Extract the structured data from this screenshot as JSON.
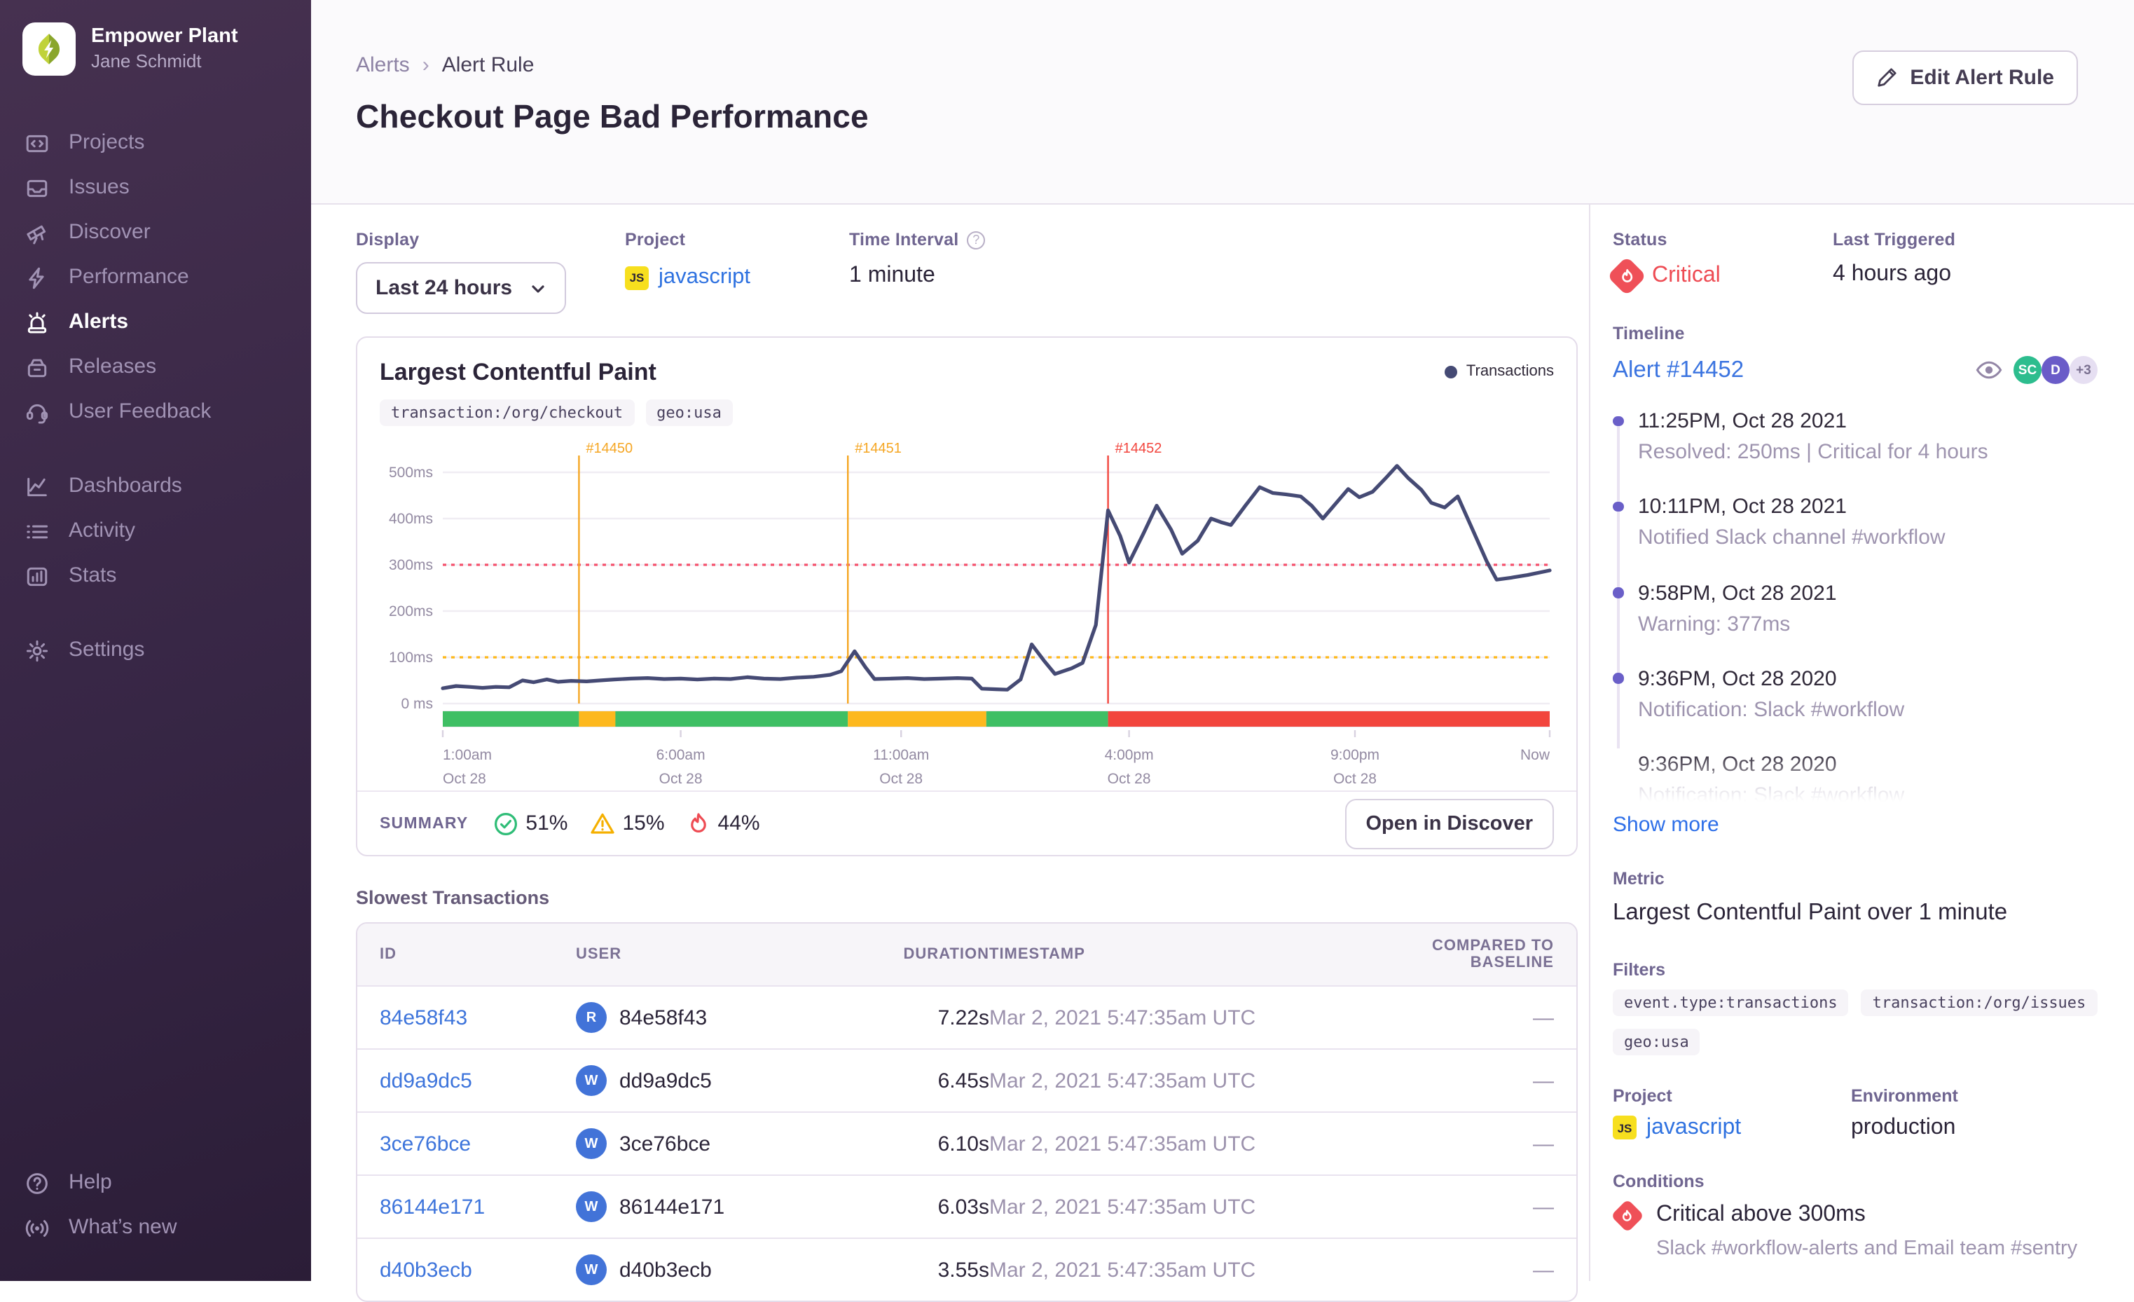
{
  "sidebar": {
    "org": "Empower Plant",
    "user": "Jane Schmidt",
    "primary": [
      {
        "label": "Projects"
      },
      {
        "label": "Issues"
      },
      {
        "label": "Discover"
      },
      {
        "label": "Performance"
      },
      {
        "label": "Alerts"
      },
      {
        "label": "Releases"
      },
      {
        "label": "User Feedback"
      }
    ],
    "secondary": [
      {
        "label": "Dashboards"
      },
      {
        "label": "Activity"
      },
      {
        "label": "Stats"
      }
    ],
    "settings_label": "Settings",
    "footer": [
      {
        "label": "Help"
      },
      {
        "label": "What’s new"
      }
    ]
  },
  "header": {
    "breadcrumb": [
      "Alerts",
      "Alert Rule"
    ],
    "breadcrumb_sep": "›",
    "title": "Checkout Page Bad Performance",
    "edit_button": "Edit Alert Rule"
  },
  "meta": {
    "display": {
      "label": "Display",
      "value": "Last 24 hours"
    },
    "project": {
      "label": "Project",
      "badge": "JS",
      "value": "javascript"
    },
    "interval": {
      "label": "Time Interval",
      "help": "?",
      "value": "1 minute"
    },
    "status": {
      "label": "Status",
      "value": "Critical"
    },
    "last_triggered": {
      "label": "Last Triggered",
      "value": "4 hours ago"
    }
  },
  "chart_data": {
    "type": "line",
    "title": "Largest Contentful Paint",
    "tags": [
      "transaction:/org/checkout",
      "geo:usa"
    ],
    "legend": [
      "Transactions"
    ],
    "ylabel": "ms",
    "ylim": [
      0,
      550
    ],
    "y_ticks": [
      {
        "value": 0,
        "label": "0 ms"
      },
      {
        "value": 100,
        "label": "100ms"
      },
      {
        "value": 200,
        "label": "200ms"
      },
      {
        "value": 300,
        "label": "300ms"
      },
      {
        "value": 400,
        "label": "400ms"
      },
      {
        "value": 500,
        "label": "500ms"
      }
    ],
    "x_ticks": [
      {
        "x": 0,
        "time": "1:00am",
        "date": "Oct 28"
      },
      {
        "x": 0.215,
        "time": "6:00am",
        "date": "Oct 28"
      },
      {
        "x": 0.414,
        "time": "11:00am",
        "date": "Oct 28"
      },
      {
        "x": 0.62,
        "time": "4:00pm",
        "date": "Oct 28"
      },
      {
        "x": 0.824,
        "time": "9:00pm",
        "date": "Oct 28"
      },
      {
        "x": 1,
        "time": "Now",
        "date": ""
      }
    ],
    "thresholds": [
      {
        "name": "critical",
        "value": 300,
        "color": "#f4506c"
      },
      {
        "name": "warning",
        "value": 100,
        "color": "#fdb71a"
      }
    ],
    "incidents": [
      {
        "x": 0.123,
        "label": "#14450",
        "color": "#f5a623"
      },
      {
        "x": 0.366,
        "label": "#14451",
        "color": "#f5a623"
      },
      {
        "x": 0.601,
        "label": "#14452",
        "color": "#f2453d"
      }
    ],
    "segment_colors": {
      "green": "#3fbf64",
      "yellow": "#fdb81e",
      "red": "#f2453d"
    },
    "status_segments": [
      [
        0,
        0.123,
        "green"
      ],
      [
        0.123,
        0.156,
        "yellow"
      ],
      [
        0.156,
        0.366,
        "green"
      ],
      [
        0.366,
        0.491,
        "yellow"
      ],
      [
        0.491,
        0.601,
        "green"
      ],
      [
        0.601,
        1,
        "red"
      ]
    ],
    "series": [
      {
        "name": "Transactions",
        "color": "#454a74",
        "points": [
          [
            0,
            33
          ],
          [
            0.012,
            38
          ],
          [
            0.024,
            36
          ],
          [
            0.036,
            34
          ],
          [
            0.048,
            36
          ],
          [
            0.06,
            35
          ],
          [
            0.072,
            50
          ],
          [
            0.082,
            46
          ],
          [
            0.094,
            52
          ],
          [
            0.104,
            47
          ],
          [
            0.116,
            49
          ],
          [
            0.13,
            48
          ],
          [
            0.142,
            50
          ],
          [
            0.155,
            52
          ],
          [
            0.17,
            54
          ],
          [
            0.185,
            55
          ],
          [
            0.2,
            53
          ],
          [
            0.215,
            54
          ],
          [
            0.23,
            52
          ],
          [
            0.245,
            54
          ],
          [
            0.26,
            53
          ],
          [
            0.275,
            57
          ],
          [
            0.29,
            54
          ],
          [
            0.305,
            53
          ],
          [
            0.32,
            56
          ],
          [
            0.335,
            58
          ],
          [
            0.35,
            62
          ],
          [
            0.36,
            70
          ],
          [
            0.372,
            113
          ],
          [
            0.382,
            78
          ],
          [
            0.39,
            53
          ],
          [
            0.405,
            54
          ],
          [
            0.42,
            55
          ],
          [
            0.435,
            53
          ],
          [
            0.45,
            54
          ],
          [
            0.465,
            55
          ],
          [
            0.478,
            54
          ],
          [
            0.487,
            32
          ],
          [
            0.5,
            31
          ],
          [
            0.51,
            30
          ],
          [
            0.522,
            52
          ],
          [
            0.532,
            128
          ],
          [
            0.543,
            93
          ],
          [
            0.553,
            64
          ],
          [
            0.568,
            76
          ],
          [
            0.578,
            88
          ],
          [
            0.59,
            170
          ],
          [
            0.601,
            418
          ],
          [
            0.612,
            362
          ],
          [
            0.62,
            305
          ],
          [
            0.633,
            368
          ],
          [
            0.645,
            428
          ],
          [
            0.658,
            376
          ],
          [
            0.668,
            324
          ],
          [
            0.682,
            352
          ],
          [
            0.694,
            400
          ],
          [
            0.703,
            392
          ],
          [
            0.712,
            386
          ],
          [
            0.725,
            428
          ],
          [
            0.738,
            468
          ],
          [
            0.75,
            455
          ],
          [
            0.762,
            452
          ],
          [
            0.775,
            448
          ],
          [
            0.785,
            428
          ],
          [
            0.795,
            400
          ],
          [
            0.808,
            436
          ],
          [
            0.818,
            464
          ],
          [
            0.828,
            446
          ],
          [
            0.84,
            458
          ],
          [
            0.852,
            488
          ],
          [
            0.862,
            514
          ],
          [
            0.872,
            488
          ],
          [
            0.884,
            462
          ],
          [
            0.893,
            434
          ],
          [
            0.905,
            424
          ],
          [
            0.917,
            448
          ],
          [
            0.93,
            378
          ],
          [
            0.943,
            308
          ],
          [
            0.952,
            268
          ],
          [
            0.965,
            272
          ],
          [
            0.98,
            278
          ],
          [
            1,
            288
          ]
        ]
      }
    ]
  },
  "summary": {
    "label": "SUMMARY",
    "ok": "51%",
    "warning": "15%",
    "critical": "44%",
    "open_button": "Open in Discover"
  },
  "transactions": {
    "title": "Slowest Transactions",
    "columns": [
      "ID",
      "USER",
      "DURATION",
      "TIMESTAMP",
      "COMPARED TO BASELINE"
    ],
    "rows": [
      {
        "id": "84e58f43",
        "avatar": "R",
        "user": "84e58f43",
        "duration": "7.22s",
        "timestamp": "Mar 2, 2021 5:47:35am UTC",
        "baseline": "—"
      },
      {
        "id": "dd9a9dc5",
        "avatar": "W",
        "user": "dd9a9dc5",
        "duration": "6.45s",
        "timestamp": "Mar 2, 2021 5:47:35am UTC",
        "baseline": "—"
      },
      {
        "id": "3ce76bce",
        "avatar": "W",
        "user": "3ce76bce",
        "duration": "6.10s",
        "timestamp": "Mar 2, 2021 5:47:35am UTC",
        "baseline": "—"
      },
      {
        "id": "86144e171",
        "avatar": "W",
        "user": "86144e171",
        "duration": "6.03s",
        "timestamp": "Mar 2, 2021 5:47:35am UTC",
        "baseline": "—"
      },
      {
        "id": "d40b3ecb",
        "avatar": "W",
        "user": "d40b3ecb",
        "duration": "3.55s",
        "timestamp": "Mar 2, 2021 5:47:35am UTC",
        "baseline": "—"
      }
    ]
  },
  "timeline": {
    "label": "Timeline",
    "alert_link": "Alert #14452",
    "avatars": [
      {
        "text": "SC"
      },
      {
        "text": "D"
      },
      {
        "text": "+3"
      }
    ],
    "items": [
      {
        "time": "11:25PM, Oct 28 2021",
        "desc": "Resolved: 250ms | Critical for 4 hours"
      },
      {
        "time": "10:11PM, Oct 28 2021",
        "desc": "Notified Slack channel #workflow"
      },
      {
        "time": "9:58PM, Oct 28 2021",
        "desc": "Warning: 377ms"
      },
      {
        "time": "9:36PM, Oct 28 2020",
        "desc": "Notification: Slack #workflow"
      },
      {
        "time": "9:36PM, Oct 28 2020",
        "desc": "Notification: Slack #workflow"
      }
    ],
    "show_more": "Show more"
  },
  "details": {
    "metric": {
      "label": "Metric",
      "value": "Largest Contentful Paint over 1 minute"
    },
    "filters": {
      "label": "Filters",
      "pills": [
        "event.type:transactions",
        "transaction:/org/issues",
        "geo:usa"
      ]
    },
    "project": {
      "label": "Project",
      "badge": "JS",
      "value": "javascript"
    },
    "environment": {
      "label": "Environment",
      "value": "production"
    },
    "conditions": {
      "label": "Conditions",
      "title": "Critical above 300ms",
      "sub": "Slack #workflow-alerts and Email team #sentry"
    }
  },
  "colors": {
    "critical": "#ee4b53",
    "warning": "#fdb81e",
    "ok": "#2fbd77",
    "accent_blue": "#3d74db",
    "chart_line": "#454a74"
  }
}
